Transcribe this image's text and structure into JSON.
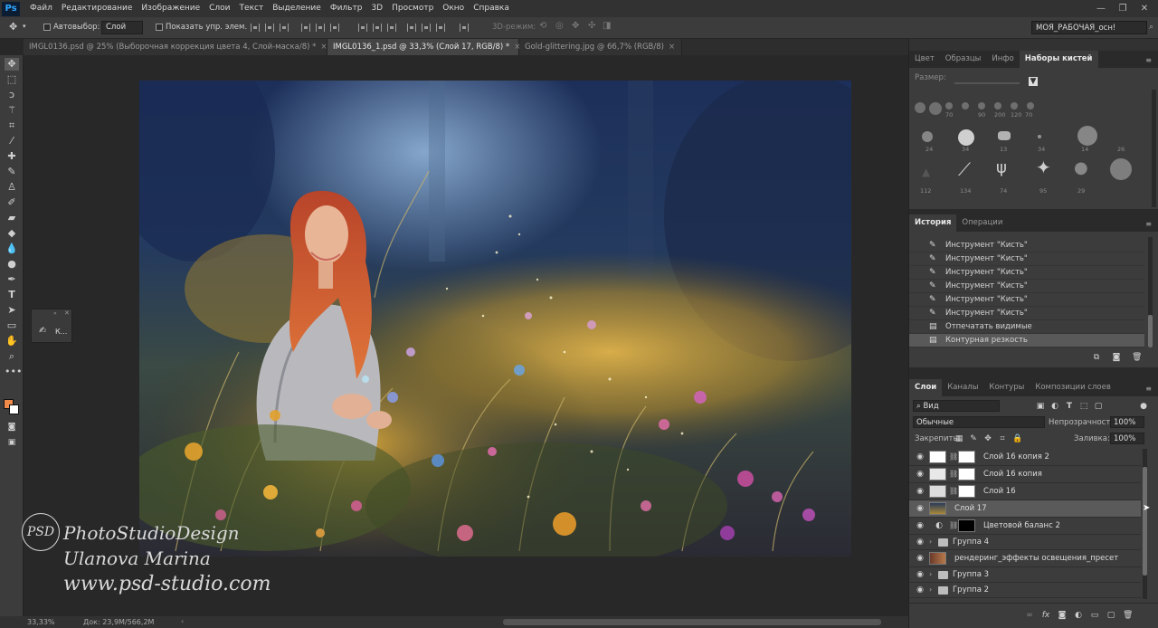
{
  "app": {
    "logo": "Ps"
  },
  "menu": [
    "Файл",
    "Редактирование",
    "Изображение",
    "Слои",
    "Текст",
    "Выделение",
    "Фильтр",
    "3D",
    "Просмотр",
    "Окно",
    "Справка"
  ],
  "window_controls": [
    "—",
    "❐",
    "✕"
  ],
  "options": {
    "autoselect_label": "Автовыбор:",
    "autoselect_value": "Слой",
    "show_controls_label": "Показать упр. элем.",
    "mode_3d_label": "3D-режим:",
    "workspace": "МОЯ_РАБОЧАЯ_осн!"
  },
  "tabs": [
    {
      "label": "IMGL0136.psd @ 25% (Выборочная коррекция цвета 4, Слой-маска/8) *",
      "close": "×"
    },
    {
      "label": "IMGL0136_1.psd @ 33,3% (Слой 17, RGB/8) *",
      "close": "×",
      "active": true
    },
    {
      "label": "Gold-glittering.jpg @ 66,7% (RGB/8)",
      "close": "×"
    }
  ],
  "mini_panel": {
    "label": "К..."
  },
  "watermark": {
    "logo": "PSD",
    "line1": "PhotoStudioDesign",
    "line2": "Ulanova Marina",
    "line3": "www.psd-studio.com"
  },
  "status": {
    "zoom": "33,33%",
    "doc": "Док: 23,9М/566,2М"
  },
  "brush_panel": {
    "tabs": [
      "Цвет",
      "Образцы",
      "Инфо",
      "Наборы кистей"
    ],
    "size_label": "Размер:",
    "numbers": [
      "70",
      "90",
      "200",
      "120",
      "70",
      "34",
      "14",
      "24",
      "34",
      "13",
      "26",
      "112",
      "134",
      "74",
      "95",
      "29"
    ]
  },
  "history": {
    "tabs": [
      "История",
      "Операции"
    ],
    "items": [
      "Инструмент \"Кисть\"",
      "Инструмент \"Кисть\"",
      "Инструмент \"Кисть\"",
      "Инструмент \"Кисть\"",
      "Инструмент \"Кисть\"",
      "Инструмент \"Кисть\"",
      "Отпечатать видимые",
      "Контурная резкость"
    ]
  },
  "layers": {
    "tabs": [
      "Слои",
      "Каналы",
      "Контуры",
      "Композиции слоев"
    ],
    "filter_kind": "Вид",
    "blend_mode": "Обычные",
    "opacity_label": "Непрозрачность:",
    "opacity_value": "100%",
    "lock_label": "Закрепить:",
    "fill_label": "Заливка:",
    "fill_value": "100%",
    "rows": [
      "Слой 16 копия 2",
      "Слой 16 копия",
      "Слой 16",
      "Слой 17",
      "Цветовой баланс 2",
      "Группа 4",
      "рендеринг_эффекты освещения_пресет",
      "Группа 3",
      "Группа 2"
    ],
    "footer_icons": [
      "∞",
      "fx",
      "◙",
      "◐",
      "▭",
      "▢",
      "🗑"
    ]
  },
  "colors": {
    "foreground": "#f08a4b",
    "background": "#ffffff",
    "accent": "#31a8ff"
  }
}
